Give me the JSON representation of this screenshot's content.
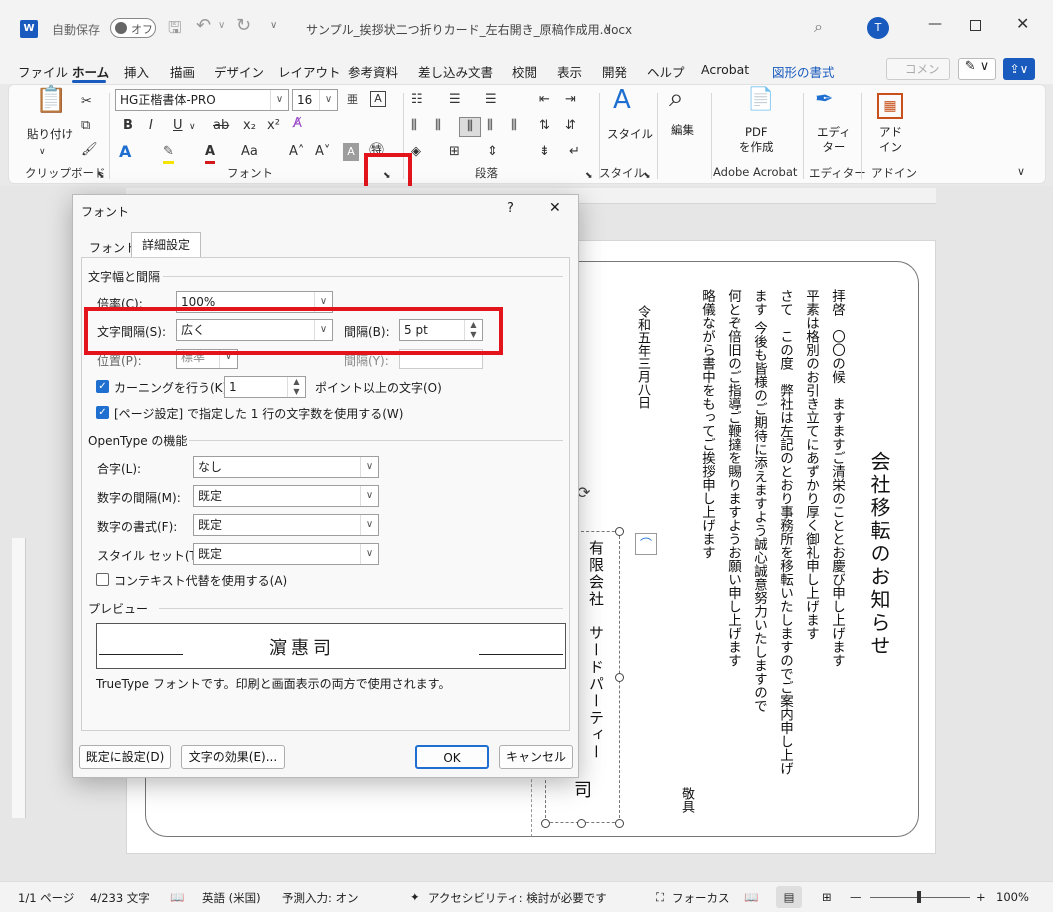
{
  "titlebar": {
    "autosave_label": "自動保存",
    "autosave_state": "オフ",
    "filename": "サンプル_挨拶状二つ折りカード_左右開き_原稿作成用.docx",
    "filename_chevron": "∨",
    "avatar_initial": "T"
  },
  "tabs": [
    "ファイル",
    "ホーム",
    "挿入",
    "描画",
    "デザイン",
    "レイアウト",
    "参考資料",
    "差し込み文書",
    "校閲",
    "表示",
    "開発",
    "ヘルプ",
    "Acrobat",
    "図形の書式"
  ],
  "comment_btn": "コメント",
  "ribbon": {
    "paste_label": "貼り付け",
    "font_name": "HG正楷書体-PRO",
    "font_size": "16",
    "groups": [
      "クリップボード",
      "フォント",
      "段落",
      "スタイル",
      "Adobe Acrobat",
      "エディター",
      "アドイン"
    ],
    "style_label": "スタイル",
    "edit_label": "編集",
    "pdf_label": "PDF\nを作成",
    "editor_label": "エディ\nター",
    "addin_label": "アド\nイン"
  },
  "document": {
    "title": "会社移転のお知らせ",
    "para1": "拝啓　〇〇の候　ますますご清栄のこととお慶び申し上げます",
    "para2": "平素は格別のお引き立てにあずかり厚く御礼申し上げます",
    "para3": "さて　この度　弊社は左記のとおり事務所を移転いたしますのでご案内申し上げ",
    "para4": "ます",
    "para5": "今後も皆様のご期待に添えますよう誠心誠意努力いたしますので",
    "para6": "何とぞ倍旧のご指導ご鞭撻を賜りますようお願い申し上げます",
    "para7": "略儀ながら書中をもってご挨拶申し上げます",
    "date": "令和五年三月八日",
    "closing": "敬具",
    "company": "有限会社　サードパーティー",
    "company_tail": "司"
  },
  "dialog": {
    "title": "フォント",
    "help": "?",
    "close": "✕",
    "tab_font": "フォント",
    "tab_advanced": "詳細設定",
    "section_spacing": "文字幅と間隔",
    "scale_label": "倍率(C):",
    "scale_value": "100%",
    "spacing_label": "文字間隔(S):",
    "spacing_value": "広く",
    "by_label": "間隔(B):",
    "by_value": "5 pt",
    "position_label": "位置(P):",
    "position_value": "標準",
    "position_by_label": "間隔(Y):",
    "kerning_label": "カーニングを行う(K):",
    "kerning_value": "1",
    "kerning_suffix": "ポイント以上の文字(O)",
    "grid_label": "[ページ設定] で指定した 1 行の文字数を使用する(W)",
    "section_opentype": "OpenType の機能",
    "ligatures_label": "合字(L):",
    "ligatures_value": "なし",
    "num_spacing_label": "数字の間隔(M):",
    "num_spacing_value": "既定",
    "num_forms_label": "数字の書式(F):",
    "num_forms_value": "既定",
    "stylistic_label": "スタイル セット(T):",
    "stylistic_value": "既定",
    "contextual_label": "コンテキスト代替を使用する(A)",
    "section_preview": "プレビュー",
    "preview_text": "濵惠司",
    "preview_note": "TrueType フォントです。印刷と画面表示の両方で使用されます。",
    "btn_default": "既定に設定(D)",
    "btn_effects": "文字の効果(E)...",
    "btn_ok": "OK",
    "btn_cancel": "キャンセル"
  },
  "status": {
    "page": "1/1 ページ",
    "words": "4/233 文字",
    "language": "英語 (米国)",
    "predict": "予測入力: オン",
    "accessibility": "アクセシビリティ: 検討が必要です",
    "focus": "フォーカス",
    "zoom": "100%"
  },
  "colors": {
    "accent": "#185abd",
    "highlight": "#e3141b",
    "check": "#1e6fd0"
  }
}
